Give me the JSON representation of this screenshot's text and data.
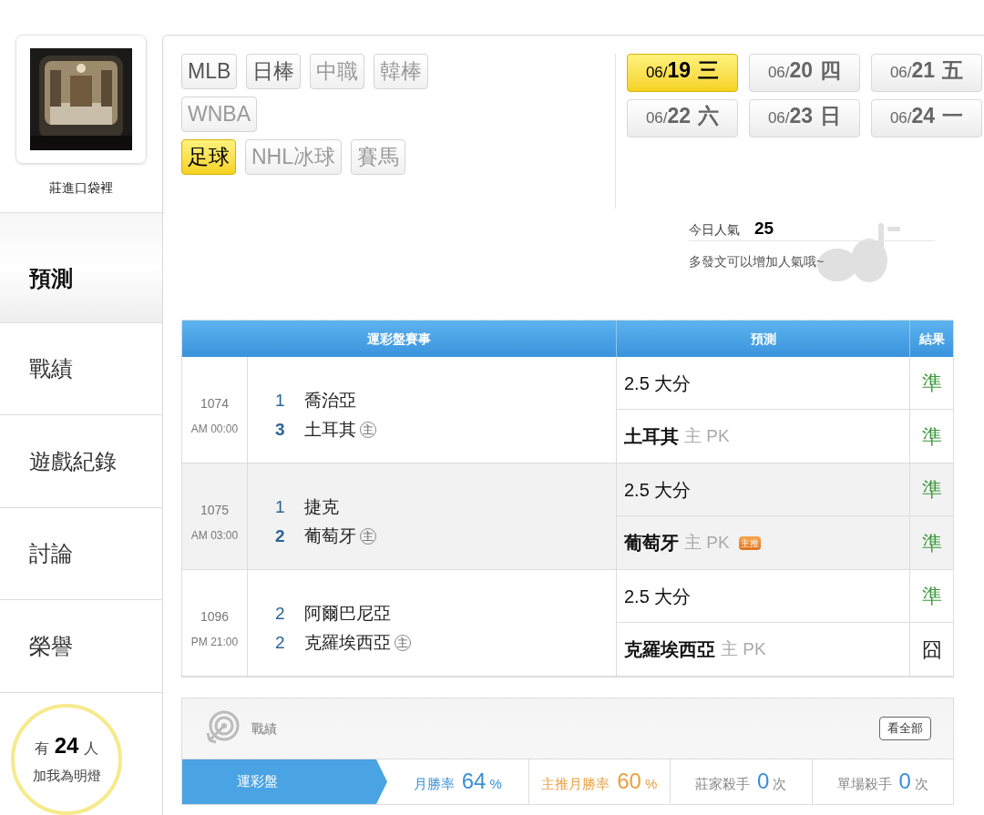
{
  "profile": {
    "name": "莊進口袋裡"
  },
  "nav": [
    {
      "label": "預測",
      "selected": true
    },
    {
      "label": "戰績",
      "selected": false
    },
    {
      "label": "遊戲紀錄",
      "selected": false
    },
    {
      "label": "討論",
      "selected": false
    },
    {
      "label": "榮譽",
      "selected": false
    }
  ],
  "followers": {
    "prefix": "有",
    "count": "24",
    "unit": "人",
    "caption": "加我為明燈"
  },
  "league_rows": [
    {
      "items": [
        {
          "label": "MLB",
          "selected": false,
          "disabled": false
        },
        {
          "label": "日棒",
          "selected": false,
          "disabled": false
        },
        {
          "label": "中職",
          "selected": false,
          "disabled": true
        },
        {
          "label": "韓棒",
          "selected": false,
          "disabled": true
        }
      ]
    },
    {
      "items": [
        {
          "label": "WNBA",
          "selected": false,
          "disabled": true
        }
      ]
    },
    {
      "items": [
        {
          "label": "足球",
          "selected": true,
          "disabled": false
        },
        {
          "label": "NHL冰球",
          "selected": false,
          "disabled": true
        },
        {
          "label": "賽馬",
          "selected": false,
          "disabled": true
        }
      ]
    }
  ],
  "dates": [
    {
      "month": "06/",
      "day": "19",
      "weekday": "三",
      "selected": true
    },
    {
      "month": "06/",
      "day": "20",
      "weekday": "四",
      "selected": false
    },
    {
      "month": "06/",
      "day": "21",
      "weekday": "五",
      "selected": false
    },
    {
      "month": "06/",
      "day": "22",
      "weekday": "六",
      "selected": false
    },
    {
      "month": "06/",
      "day": "23",
      "weekday": "日",
      "selected": false
    },
    {
      "month": "06/",
      "day": "24",
      "weekday": "一",
      "selected": false
    }
  ],
  "popularity": {
    "label": "今日人氣",
    "value": "25",
    "hint": "多發文可以增加人氣哦~"
  },
  "table": {
    "columns": [
      "運彩盤賽事",
      "預測",
      "結果"
    ],
    "matches": [
      {
        "id": "1074",
        "time": "AM 00:00",
        "teams": [
          {
            "score": "1",
            "name": "喬治亞",
            "winner": false
          },
          {
            "score": "3",
            "name": "土耳其",
            "winner": true,
            "home_mark": "主"
          }
        ],
        "picks": [
          {
            "main": "2.5 大分",
            "result": "準",
            "kind": "hit"
          },
          {
            "main": "土耳其",
            "tail": "主 PK",
            "result": "準",
            "kind": "hit"
          }
        ]
      },
      {
        "id": "1075",
        "time": "AM 03:00",
        "teams": [
          {
            "score": "1",
            "name": "捷克",
            "winner": false
          },
          {
            "score": "2",
            "name": "葡萄牙",
            "winner": true,
            "home_mark": "主"
          }
        ],
        "picks": [
          {
            "main": "2.5 大分",
            "result": "準",
            "kind": "hit"
          },
          {
            "main": "葡萄牙",
            "tail": "主 PK",
            "badge": "主推",
            "result": "準",
            "kind": "hit"
          }
        ]
      },
      {
        "id": "1096",
        "time": "PM 21:00",
        "teams": [
          {
            "score": "2",
            "name": "阿爾巴尼亞",
            "winner": false
          },
          {
            "score": "2",
            "name": "克羅埃西亞",
            "winner": false,
            "home_mark": "主"
          }
        ],
        "picks": [
          {
            "main": "2.5 大分",
            "result": "準",
            "kind": "hit"
          },
          {
            "main": "克羅埃西亞",
            "tail": "主 PK",
            "result": "囧",
            "kind": "miss"
          }
        ]
      }
    ]
  },
  "record": {
    "title": "戰績",
    "button": "看全部",
    "tabs": [
      {
        "label": "運彩盤",
        "selected": true
      },
      {
        "label": "月勝率",
        "value": "64",
        "unit": "%",
        "kind": "rate",
        "selected": false
      },
      {
        "label": "主推月勝率",
        "value": "60",
        "unit": "%",
        "kind": "featured",
        "selected": false
      },
      {
        "label": "莊家殺手",
        "value": "0",
        "unit": "次",
        "kind": "count",
        "selected": false
      },
      {
        "label": "單場殺手",
        "value": "0",
        "unit": "次",
        "kind": "count",
        "selected": false
      }
    ]
  }
}
